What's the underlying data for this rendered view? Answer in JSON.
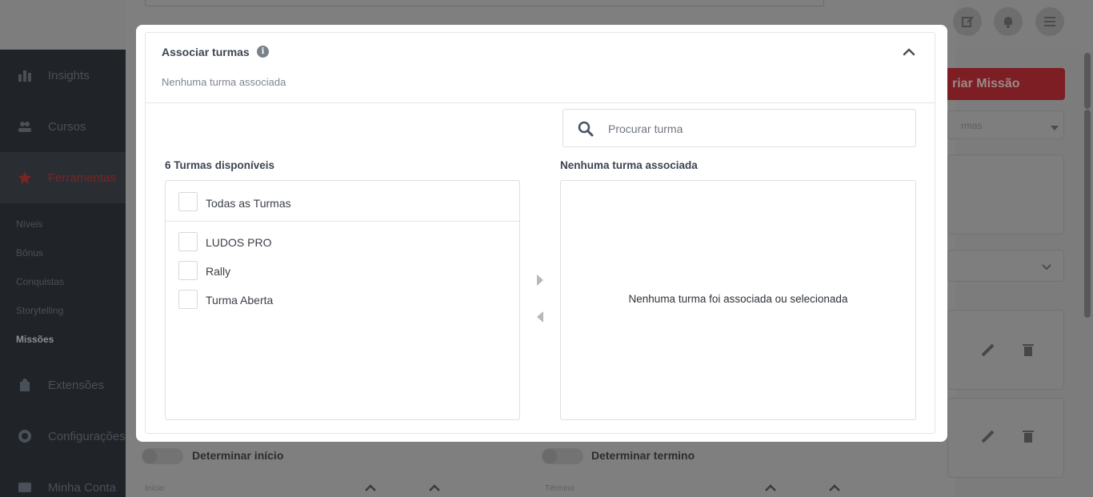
{
  "background": {
    "sidebar": {
      "items": [
        {
          "label": "Insights",
          "icon": "bar-chart-icon"
        },
        {
          "label": "Cursos",
          "icon": "users-icon"
        },
        {
          "label": "Ferramentas",
          "icon": "star-icon",
          "active": true
        },
        {
          "label": "Extensões",
          "icon": "puzzle-icon"
        },
        {
          "label": "Configurações",
          "icon": "gear-icon"
        },
        {
          "label": "Minha Conta",
          "icon": "card-icon"
        }
      ],
      "subitems": [
        "Níveis",
        "Bônus",
        "Conquistas",
        "Storytelling",
        "Missões"
      ],
      "current_subitem": "Missões"
    },
    "header_icons": [
      "edit-icon",
      "bell-icon",
      "menu-icon"
    ],
    "create_button_label": "riar Missão",
    "filter_select_value": "rmas",
    "toggles": [
      {
        "label": "Determinar início",
        "field_label": "Início"
      },
      {
        "label": "Determinar termino",
        "field_label": "Término"
      }
    ]
  },
  "modal": {
    "title": "Associar turmas",
    "subtitle": "Nenhuma turma associada",
    "search": {
      "placeholder": "Procurar turma",
      "value": ""
    },
    "available": {
      "heading": "6 Turmas disponíveis",
      "select_all_label": "Todas as Turmas",
      "items": [
        {
          "label": "LUDOS PRO",
          "checked": false
        },
        {
          "label": "Rally",
          "checked": false
        },
        {
          "label": "Turma Aberta",
          "checked": false
        }
      ]
    },
    "associated": {
      "heading": "Nenhuma turma associada",
      "empty_message": "Nenhuma turma foi associada ou selecionada"
    }
  },
  "colors": {
    "accent_red": "#d93a44",
    "text_dark": "#3d4552",
    "border": "#dcdfe3",
    "arrow": "#b5b9be"
  }
}
